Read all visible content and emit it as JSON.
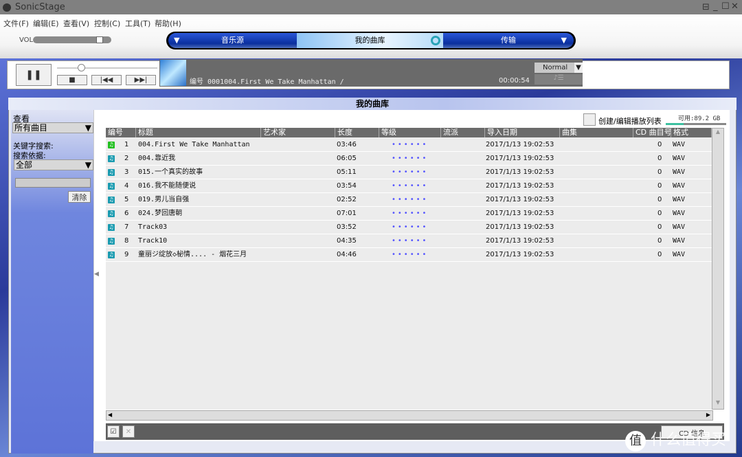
{
  "app": {
    "title": "SonicStage",
    "window_buttons": [
      "restore-mini",
      "minimize",
      "maximize",
      "close"
    ]
  },
  "menu": [
    "文件(F)",
    "编辑(E)",
    "查看(V)",
    "控制(C)",
    "工具(T)",
    "帮助(H)"
  ],
  "volume": {
    "label": "VOL",
    "level": 0.88
  },
  "nav": {
    "tabs": [
      {
        "label": "音乐源",
        "active": false
      },
      {
        "label": "我的曲库",
        "active": true
      },
      {
        "label": "传输",
        "active": false
      }
    ]
  },
  "player": {
    "now_playing": "编号 0001004.First We Take Manhattan /",
    "time": "00:00:54",
    "mode": "Normal"
  },
  "main": {
    "title": "我的曲库",
    "playlist_button": "创建/编辑播放列表",
    "available": "可用:89.2  GB",
    "cd_info": "CD 信息"
  },
  "sidebar": {
    "view_label": "查看",
    "view_value": "所有曲目",
    "keyword_label": "关键字搜索:",
    "search_by_label": "搜索依据:",
    "search_by_value": "全部",
    "search_value": "",
    "clear_button": "清除"
  },
  "table": {
    "columns": [
      "编号",
      "标题",
      "艺术家",
      "长度",
      "等级",
      "流派",
      "导入日期",
      "曲集",
      "CD 曲目号",
      "格式"
    ],
    "rows": [
      {
        "no": "1",
        "title": "004.First We Take Manhattan",
        "length": "03:46",
        "date": "2017/1/13 19:02:53",
        "cd": "0",
        "format": "WAV",
        "playing": true
      },
      {
        "no": "2",
        "title": "004.靠近我",
        "length": "06:05",
        "date": "2017/1/13 19:02:53",
        "cd": "0",
        "format": "WAV"
      },
      {
        "no": "3",
        "title": "015.一个真实的故事",
        "length": "05:11",
        "date": "2017/1/13 19:02:53",
        "cd": "0",
        "format": "WAV"
      },
      {
        "no": "4",
        "title": "016.我不能随便说",
        "length": "03:54",
        "date": "2017/1/13 19:02:53",
        "cd": "0",
        "format": "WAV"
      },
      {
        "no": "5",
        "title": "019.男儿当自强",
        "length": "02:52",
        "date": "2017/1/13 19:02:53",
        "cd": "0",
        "format": "WAV"
      },
      {
        "no": "6",
        "title": "024.梦回唐朝",
        "length": "07:01",
        "date": "2017/1/13 19:02:53",
        "cd": "0",
        "format": "WAV"
      },
      {
        "no": "7",
        "title": "Track03",
        "length": "03:52",
        "date": "2017/1/13 19:02:53",
        "cd": "0",
        "format": "WAV"
      },
      {
        "no": "8",
        "title": "Track10",
        "length": "04:35",
        "date": "2017/1/13 19:02:53",
        "cd": "0",
        "format": "WAV"
      },
      {
        "no": "9",
        "title": "童丽ジ绽放◇柲情.... - 烟花三月",
        "length": "04:46",
        "date": "2017/1/13 19:02:53",
        "cd": "0",
        "format": "WAV"
      }
    ]
  },
  "watermark": "值 什么值得买"
}
